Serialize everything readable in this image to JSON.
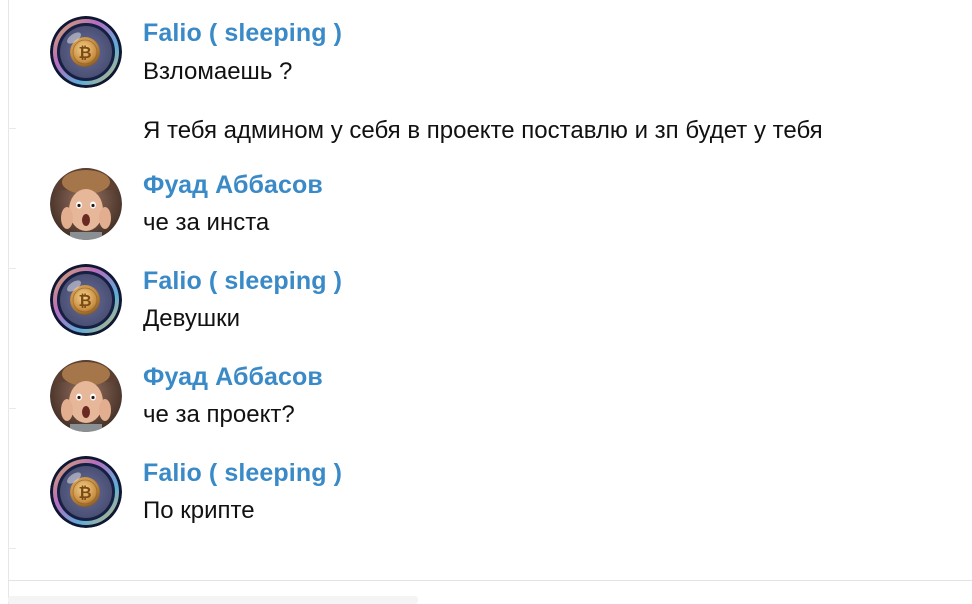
{
  "messages": [
    {
      "sender": "Falio ( sleeping )",
      "avatar": "bitcoin-bubble-avatar",
      "lines": [
        "Взломаешь ?",
        "Я тебя админом у себя в проекте поставлю и зп будет у тебя"
      ]
    },
    {
      "sender": "Фуад Аббасов",
      "avatar": "surprised-face-avatar",
      "lines": [
        "че за инста"
      ]
    },
    {
      "sender": "Falio ( sleeping )",
      "avatar": "bitcoin-bubble-avatar",
      "lines": [
        "Девушки"
      ]
    },
    {
      "sender": "Фуад Аббасов",
      "avatar": "surprised-face-avatar",
      "lines": [
        "че за проект?"
      ]
    },
    {
      "sender": "Falio ( sleeping )",
      "avatar": "bitcoin-bubble-avatar",
      "lines": [
        "По крипте"
      ]
    }
  ],
  "colors": {
    "sender_name": "#3a8ac7",
    "message_text": "#111111",
    "background": "#ffffff"
  }
}
